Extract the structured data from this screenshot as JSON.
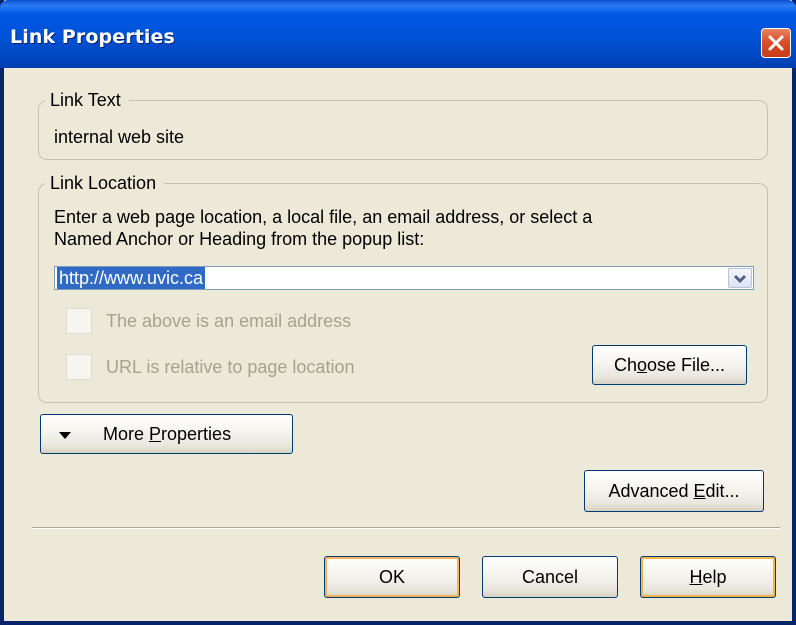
{
  "window": {
    "title": "Link Properties",
    "close_icon": "close-icon",
    "accent": "#0054e3",
    "close_color": "#d9502a"
  },
  "link_text": {
    "legend": "Link Text",
    "value": "internal web site"
  },
  "link_location": {
    "legend": "Link Location",
    "instructions_line1": "Enter a web page location, a local file, an email address, or select a",
    "instructions_line2": "Named Anchor or Heading from the popup list:",
    "url_value": "http://www.uvic.ca",
    "dropdown_icon": "chevron-down-icon",
    "email_checkbox_label": "The above is an email address",
    "email_checked": false,
    "relative_checkbox_label": "URL is relative to page location",
    "relative_checked": false,
    "choose_file": {
      "pre": "Ch",
      "key": "o",
      "post": "ose File..."
    }
  },
  "more_properties": {
    "pre": "More ",
    "key": "P",
    "post": "roperties",
    "icon": "triangle-down-icon"
  },
  "advanced_edit": {
    "pre": "Advanced ",
    "key": "E",
    "post": "dit..."
  },
  "footer": {
    "ok_label": "OK",
    "cancel_label": "Cancel",
    "help": {
      "pre": "",
      "key": "H",
      "post": "elp"
    }
  }
}
